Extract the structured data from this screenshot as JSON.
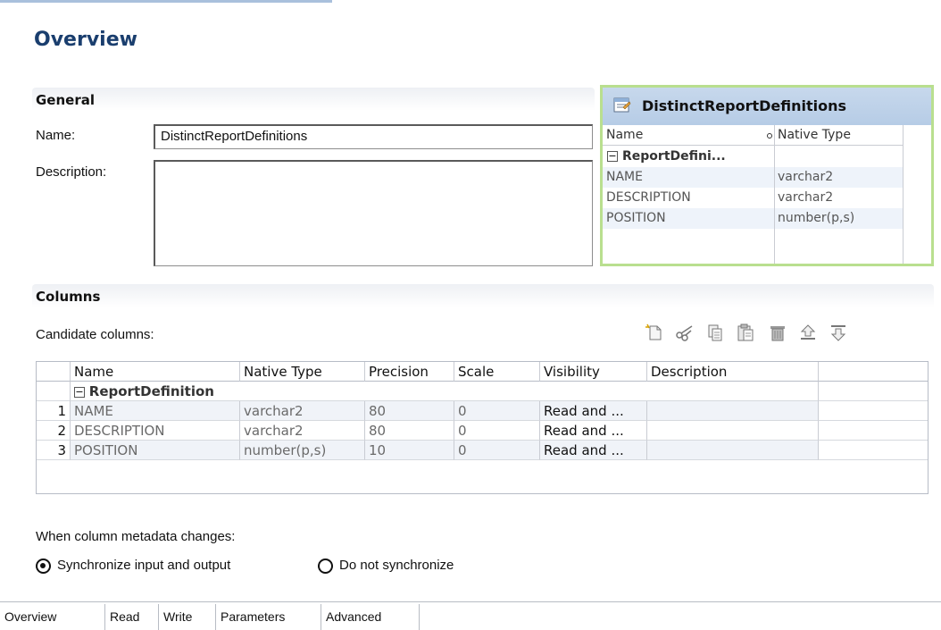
{
  "page": {
    "title": "Overview"
  },
  "general": {
    "header": "General",
    "name_label": "Name:",
    "name_value": "DistinctReportDefinitions",
    "description_label": "Description:",
    "description_value": ""
  },
  "preview": {
    "title": "DistinctReportDefinitions",
    "icon": "data-object-icon",
    "col_headers": [
      "Name",
      "Native Type"
    ],
    "group": "ReportDefini...",
    "rows": [
      {
        "name": "NAME",
        "type": "varchar2"
      },
      {
        "name": "DESCRIPTION",
        "type": "varchar2"
      },
      {
        "name": "POSITION",
        "type": "number(p,s)"
      }
    ]
  },
  "columns": {
    "header": "Columns",
    "candidate_label": "Candidate columns:",
    "toolbar": [
      "new-icon",
      "cut-icon",
      "copy-icon",
      "paste-icon",
      "delete-icon",
      "move-up-icon",
      "move-down-icon"
    ],
    "headers": [
      "Name",
      "Native Type",
      "Precision",
      "Scale",
      "Visibility",
      "Description"
    ],
    "group": "ReportDefinition",
    "rows": [
      {
        "num": "1",
        "name": "NAME",
        "type": "varchar2",
        "precision": "80",
        "scale": "0",
        "visibility": "Read and ...",
        "description": ""
      },
      {
        "num": "2",
        "name": "DESCRIPTION",
        "type": "varchar2",
        "precision": "80",
        "scale": "0",
        "visibility": "Read and ...",
        "description": ""
      },
      {
        "num": "3",
        "name": "POSITION",
        "type": "number(p,s)",
        "precision": "10",
        "scale": "0",
        "visibility": "Read and ...",
        "description": ""
      }
    ]
  },
  "metadata": {
    "label": "When column metadata changes:",
    "options": [
      {
        "label": "Synchronize input and output",
        "checked": true
      },
      {
        "label": "Do not synchronize",
        "checked": false
      }
    ]
  },
  "tabs": [
    "Overview",
    "Read",
    "Write",
    "Parameters",
    "Advanced"
  ],
  "colors": {
    "title": "#1a3e6e",
    "preview_border": "#b9df8f",
    "preview_header": "#c7d8ec"
  }
}
